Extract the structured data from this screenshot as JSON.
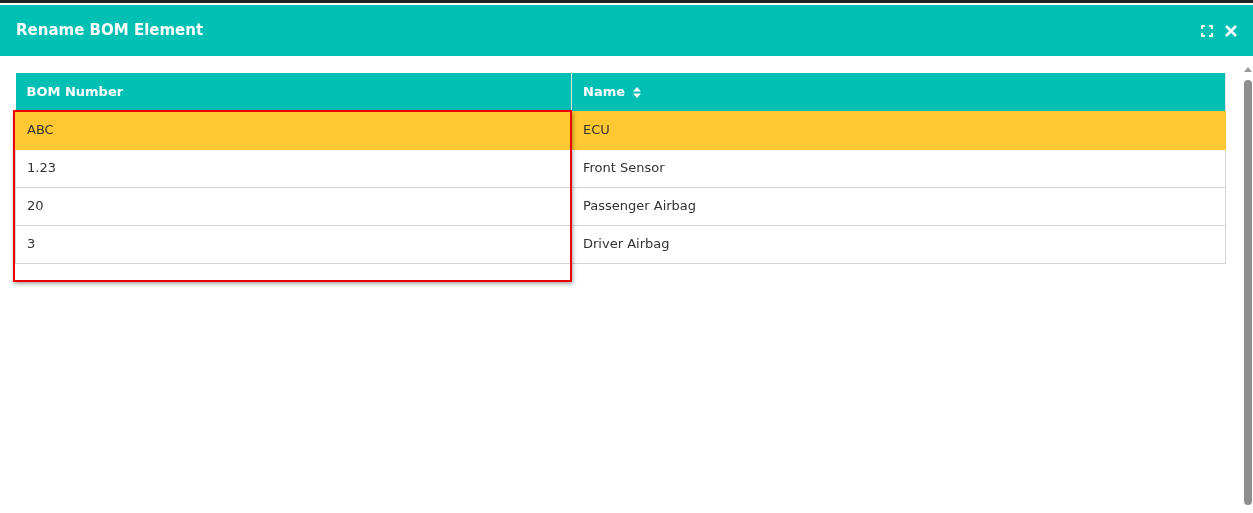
{
  "window": {
    "title": "Rename BOM Element"
  },
  "table": {
    "columns": [
      {
        "label": "BOM Number",
        "sortable": false
      },
      {
        "label": "Name",
        "sortable": true
      }
    ],
    "rows": [
      {
        "cells": [
          "ABC",
          "ECU"
        ],
        "selected": true
      },
      {
        "cells": [
          "1.23",
          "Front Sensor"
        ],
        "selected": false
      },
      {
        "cells": [
          "20",
          "Passenger Airbag"
        ],
        "selected": false
      },
      {
        "cells": [
          "3",
          "Driver Airbag"
        ],
        "selected": false
      }
    ]
  },
  "highlight_frame": true
}
